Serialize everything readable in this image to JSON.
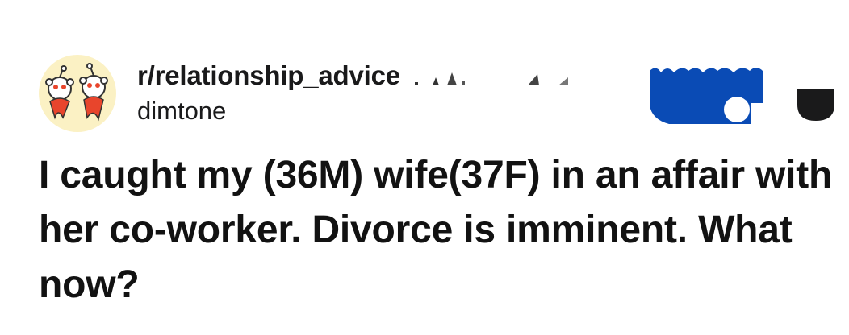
{
  "post": {
    "subreddit": "r/relationship_advice",
    "username": "dimtone",
    "title": "I caught my (36M) wife(37F) in an affair with her co-worker. Divorce is imminent. What now?"
  },
  "icons": {
    "avatar": "snoo-avatar-icon",
    "awards": "award-icon",
    "badge": "shield-badge-icon"
  },
  "colors": {
    "text": "#1a1a1b",
    "award_blue": "#0a4bb5",
    "avatar_bg": "#fbf1c4",
    "badge": "#1a1a1b"
  }
}
